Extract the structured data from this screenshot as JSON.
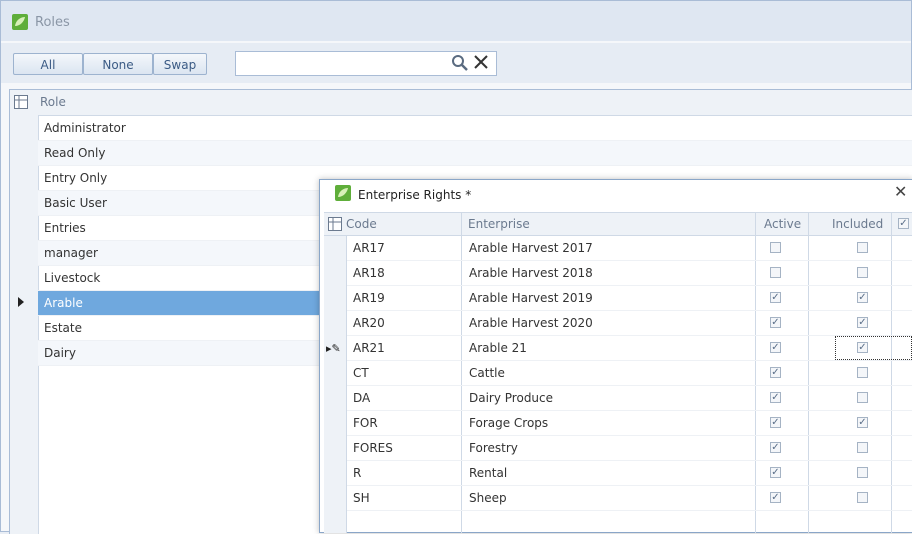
{
  "window": {
    "title": "Roles",
    "icon": "app-leaf-icon"
  },
  "toolbar": {
    "all_label": "All",
    "none_label": "None",
    "swap_label": "Swap",
    "search_value": "",
    "search_icon": "search-icon",
    "clear_icon": "clear-icon"
  },
  "roles_grid": {
    "header": "Role",
    "rows": [
      "Administrator",
      "Read Only",
      "Entry Only",
      "Basic User",
      "Entries",
      "manager",
      "Livestock",
      "Arable",
      "Estate",
      "Dairy"
    ],
    "selected": "Arable"
  },
  "dialog": {
    "title": "Enterprise Rights *",
    "close_label": "✕",
    "columns": {
      "code": "Code",
      "enterprise": "Enterprise",
      "active": "Active",
      "included": "Included"
    },
    "rows": [
      {
        "code": "AR17",
        "enterprise": "Arable Harvest 2017",
        "active": false,
        "included": false
      },
      {
        "code": "AR18",
        "enterprise": "Arable Harvest 2018",
        "active": false,
        "included": false
      },
      {
        "code": "AR19",
        "enterprise": "Arable Harvest 2019",
        "active": true,
        "included": true
      },
      {
        "code": "AR20",
        "enterprise": "Arable Harvest 2020",
        "active": true,
        "included": true
      },
      {
        "code": "AR21",
        "enterprise": "Arable 21",
        "active": true,
        "included": true
      },
      {
        "code": "CT",
        "enterprise": "Cattle",
        "active": true,
        "included": false
      },
      {
        "code": "DA",
        "enterprise": "Dairy Produce",
        "active": true,
        "included": false
      },
      {
        "code": "FOR",
        "enterprise": "Forage Crops",
        "active": true,
        "included": true
      },
      {
        "code": "FORES",
        "enterprise": "Forestry",
        "active": true,
        "included": false
      },
      {
        "code": "R",
        "enterprise": "Rental",
        "active": true,
        "included": false
      },
      {
        "code": "SH",
        "enterprise": "Sheep",
        "active": true,
        "included": false
      }
    ],
    "editing_row": "AR21"
  },
  "colors": {
    "accent": "#6fa8de",
    "border": "#a9bcd6",
    "header_bg": "#eef2f7"
  }
}
